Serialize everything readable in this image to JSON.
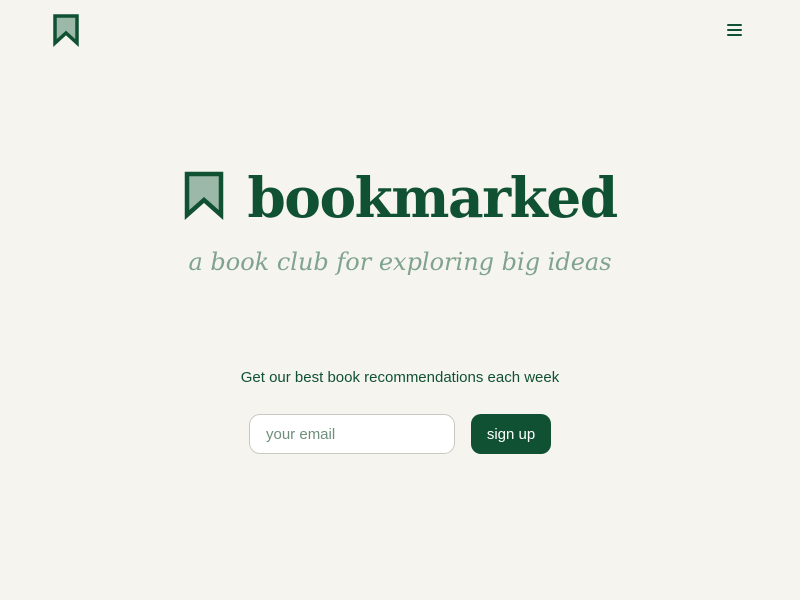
{
  "header": {
    "logo_icon": "bookmark-icon",
    "menu_icon": "hamburger-menu-icon"
  },
  "hero": {
    "icon": "bookmark-icon",
    "title": "bookmarked",
    "tagline": "a book club for exploring big ideas"
  },
  "newsletter": {
    "text": "Get our best book recommendations each week",
    "email_placeholder": "your email",
    "email_value": "",
    "signup_label": "sign up"
  },
  "colors": {
    "background": "#f6f4ef",
    "brand_green": "#0f5132",
    "tagline_green": "#7fa38e",
    "bookmark_fill": "#9cb8a8",
    "input_border": "#c9c9c3"
  }
}
